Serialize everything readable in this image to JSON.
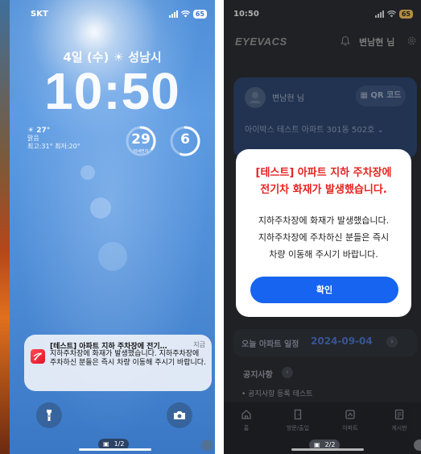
{
  "lock_screen": {
    "carrier": "SKT",
    "battery": "65",
    "date": "4일 (수) ☀ 성남시",
    "time": "10:50",
    "weather": {
      "temperature": "☀ 27°",
      "condition": "맑음",
      "high_low": "최고:31° 최저:20°"
    },
    "widgets": [
      {
        "value": "29",
        "label": "미세먼지",
        "level": 0.35
      },
      {
        "value": "6",
        "label": "",
        "level": 0.55
      }
    ],
    "notification": {
      "title": "[테스트] 아파트 지하 주차장에 전기…",
      "time": "지금",
      "body": "지하주차장에 화재가 발생했습니다. 지하주차장에 주차하신 분들은 즉시 차량 이동해 주시기 바랍니다."
    },
    "page_indicator": "1/2",
    "icons": [
      "flashlight-icon",
      "camera-icon"
    ]
  },
  "app_screen": {
    "status_time": "10:50",
    "battery": "65",
    "header": {
      "brand": "EYEVACS",
      "user_label": "변남현 님"
    },
    "card": {
      "user_name": "변남현 님",
      "qr_button": "QR 코드",
      "apartment": "아이박스 테스트 아파트 301동 502호"
    },
    "modal": {
      "title_line1": "[테스트] 아파트 지하 주차장에",
      "title_line2": "전기차 화재가 발생했습니다.",
      "body_line1": "지하주차장에 화재가 발생했습니다.",
      "body_line2": "지하주차장에 주차하신 분들은 즉시",
      "body_line3": "차량 이동해 주시기 바랍니다.",
      "confirm_label": "확인"
    },
    "schedule": {
      "label": "오늘 아파트 일정",
      "date": "2024-09-04"
    },
    "notices": {
      "heading": "공지사항",
      "items": [
        "• 공지사항 등록 테스트"
      ]
    },
    "tabs": [
      {
        "label": "홈"
      },
      {
        "label": "방문/출입"
      },
      {
        "label": "아파트"
      },
      {
        "label": "게시판"
      }
    ],
    "page_indicator": "2/2",
    "colors": {
      "alert_red": "#e5231f",
      "primary_blue": "#1664f0",
      "date_blue": "#3c5fa8"
    }
  }
}
